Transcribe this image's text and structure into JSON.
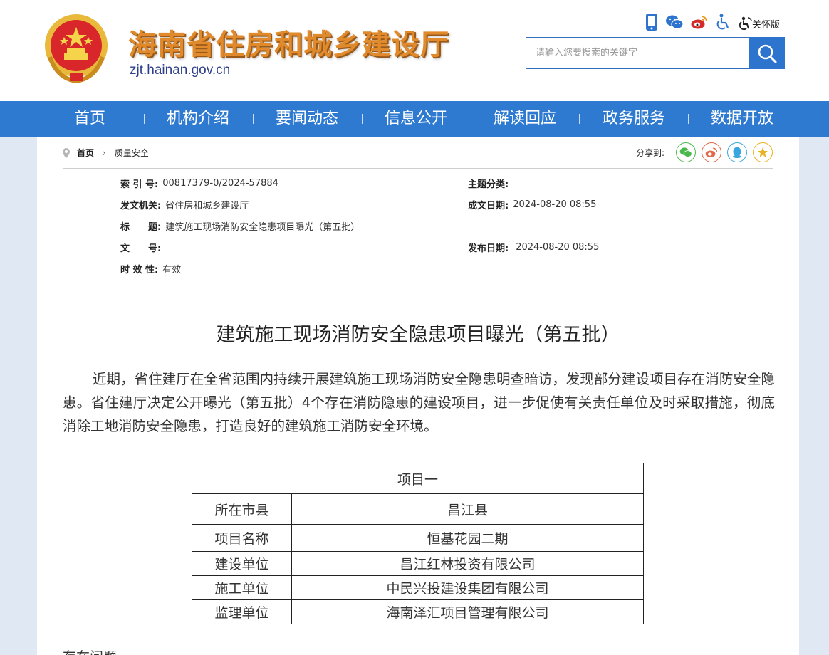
{
  "header": {
    "site_title": "海南省住房和城乡建设厅",
    "site_url": "zjt.hainan.gov.cn",
    "tools": {
      "icons": [
        "mobile-icon",
        "wechat-icon",
        "weibo-icon",
        "accessibility-icon"
      ],
      "care_mode_label": "关怀版"
    },
    "search": {
      "placeholder": "请输入您要搜索的关键字"
    }
  },
  "nav": {
    "items": [
      {
        "label": "首页"
      },
      {
        "label": "机构介绍"
      },
      {
        "label": "要闻动态"
      },
      {
        "label": "信息公开"
      },
      {
        "label": "解读回应"
      },
      {
        "label": "政务服务"
      },
      {
        "label": "数据开放"
      }
    ]
  },
  "breadcrumb": {
    "home": "首页",
    "current": "质量安全"
  },
  "share": {
    "label": "分享到:"
  },
  "meta": {
    "index_key": "索 引 号:",
    "index_val": "00817379-0/2024-57884",
    "topic_key": "主题分类:",
    "topic_val": "",
    "issuer_key": "发文机关:",
    "issuer_val": "省住房和城乡建设厅",
    "created_key": "成文日期:",
    "created_val": "2024-08-20 08:55",
    "title_key": "标　　题:",
    "title_val": "建筑施工现场消防安全隐患项目曝光（第五批）",
    "docno_key": "文　　号:",
    "docno_val": "",
    "published_key": "发布日期:",
    "published_val": "2024-08-20 08:55",
    "validity_key": "时 效 性:",
    "validity_val": "有效"
  },
  "article": {
    "title": "建筑施工现场消防安全隐患项目曝光（第五批）",
    "intro": "近期，省住建厅在全省范围内持续开展建筑施工现场消防安全隐患明查暗访，发现部分建设项目存在消防安全隐患。省住建厅决定公开曝光（第五批）4个存在消防隐患的建设项目，进一步促使有关责任单位及时采取措施，彻底消除工地消防安全隐患，打造良好的建筑施工消防安全环境。",
    "table": {
      "caption": "项目一",
      "rows": [
        {
          "label": "所在市县",
          "value": "昌江县"
        },
        {
          "label": "项目名称",
          "value": "恒基花园二期"
        },
        {
          "label": "建设单位",
          "value": "昌江红林投资有限公司"
        },
        {
          "label": "施工单位",
          "value": "中民兴投建设集团有限公司"
        },
        {
          "label": "监理单位",
          "value": "海南泽汇项目管理有限公司"
        }
      ]
    },
    "next_heading": "存在问题"
  }
}
